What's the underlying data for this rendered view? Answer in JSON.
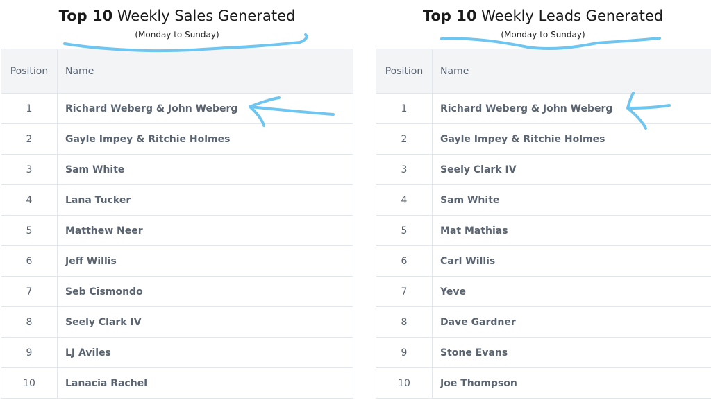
{
  "tables": [
    {
      "title_strong": "Top 10",
      "title_rest": " Weekly Sales Generated",
      "subtitle": "(Monday to Sunday)",
      "headers": {
        "position": "Position",
        "name": "Name"
      },
      "rows": [
        {
          "position": "1",
          "name": "Richard Weberg & John Weberg"
        },
        {
          "position": "2",
          "name": "Gayle Impey & Ritchie Holmes"
        },
        {
          "position": "3",
          "name": "Sam White"
        },
        {
          "position": "4",
          "name": "Lana Tucker"
        },
        {
          "position": "5",
          "name": "Matthew Neer"
        },
        {
          "position": "6",
          "name": "Jeff Willis"
        },
        {
          "position": "7",
          "name": "Seb Cismondo"
        },
        {
          "position": "8",
          "name": "Seely Clark IV"
        },
        {
          "position": "9",
          "name": "LJ Aviles"
        },
        {
          "position": "10",
          "name": "Lanacia Rachel"
        }
      ]
    },
    {
      "title_strong": "Top 10",
      "title_rest": " Weekly Leads Generated",
      "subtitle": "(Monday to Sunday)",
      "headers": {
        "position": "Position",
        "name": "Name"
      },
      "rows": [
        {
          "position": "1",
          "name": "Richard Weberg & John Weberg"
        },
        {
          "position": "2",
          "name": "Gayle Impey & Ritchie Holmes"
        },
        {
          "position": "3",
          "name": "Seely Clark IV"
        },
        {
          "position": "4",
          "name": "Sam White"
        },
        {
          "position": "5",
          "name": "Mat Mathias"
        },
        {
          "position": "6",
          "name": "Carl Willis"
        },
        {
          "position": "7",
          "name": "Yeve"
        },
        {
          "position": "8",
          "name": "Dave Gardner"
        },
        {
          "position": "9",
          "name": "Stone Evans"
        },
        {
          "position": "10",
          "name": "Joe Thompson"
        }
      ]
    }
  ],
  "colors": {
    "annotation": "#6ec6f0",
    "header_bg": "#f3f4f6",
    "border": "#e3e6ea",
    "cell_text": "#5a6470"
  }
}
